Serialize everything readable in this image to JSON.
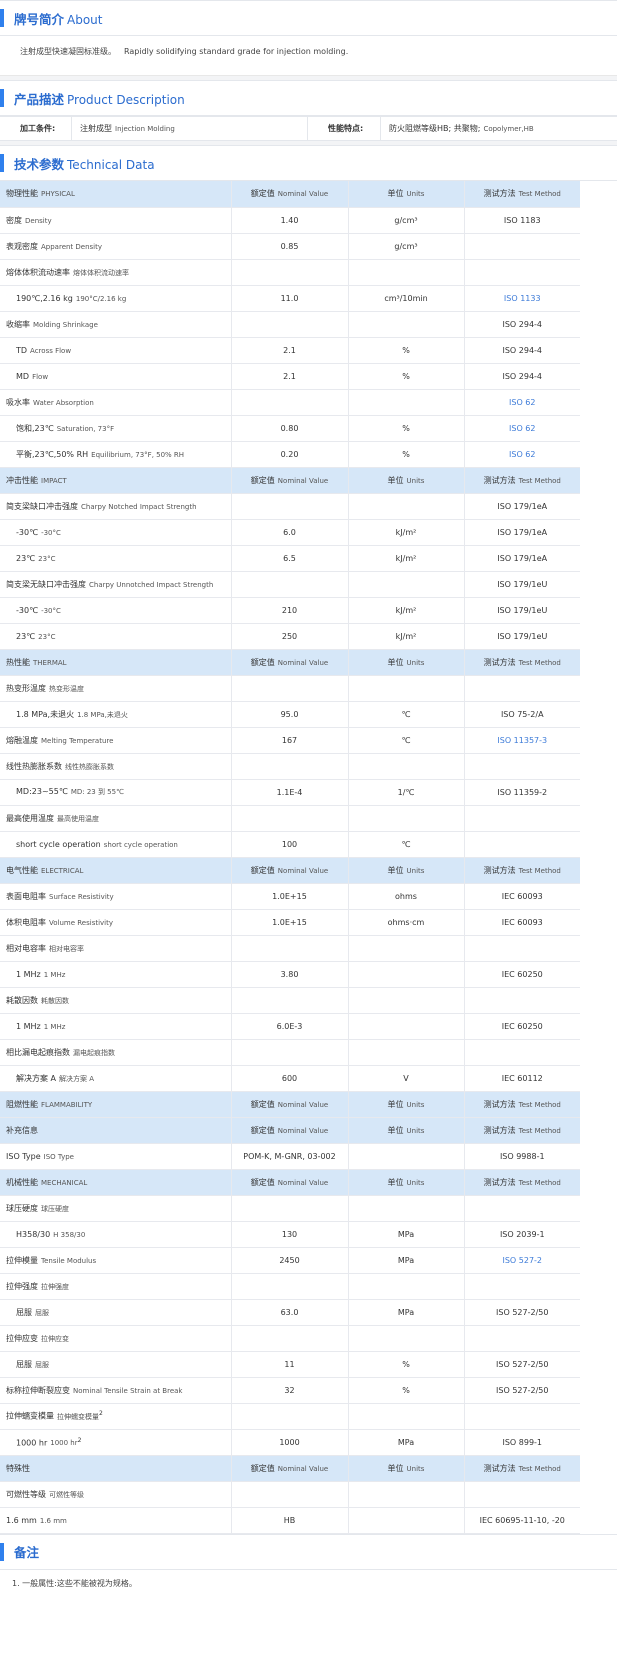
{
  "about": {
    "title_zh": "牌号简介",
    "title_en": "About",
    "text_zh": "注射成型快速凝固标准级。",
    "text_en": "Rapidly solidifying standard grade for injection molding."
  },
  "product_description": {
    "title_zh": "产品描述",
    "title_en": "Product Description",
    "processing_label": "加工条件:",
    "processing_value_zh": "注射成型",
    "processing_value_en": "Injection Molding",
    "features_label": "性能特点:",
    "features_value_zh": "防火阻燃等级HB; 共聚物;",
    "features_value_en": "Copolymer,HB"
  },
  "technical_data": {
    "title_zh": "技术参数",
    "title_en": "Technical Data",
    "rows": [
      {
        "type": "cat",
        "zh": "物理性能",
        "en": "PHYSICAL"
      },
      {
        "zh": "密度",
        "en": "Density",
        "value": "1.40",
        "unit": "g/cm³",
        "method": "ISO 1183"
      },
      {
        "zh": "表观密度",
        "en": "Apparent Density",
        "value": "0.85",
        "unit": "g/cm³",
        "method": ""
      },
      {
        "zh": "熔体体积流动速率",
        "en": "熔体体积流动速率",
        "value": "",
        "unit": "",
        "method": ""
      },
      {
        "sub": true,
        "zh": "190℃,2.16 kg",
        "en": "190°C/2.16 kg",
        "value": "11.0",
        "unit": "cm³/10min",
        "method": "ISO 1133",
        "link": true
      },
      {
        "zh": "收缩率",
        "en": "Molding Shrinkage",
        "value": "",
        "unit": "",
        "method": "ISO 294-4"
      },
      {
        "sub": true,
        "zh": "TD",
        "en": "Across Flow",
        "value": "2.1",
        "unit": "%",
        "method": "ISO 294-4"
      },
      {
        "sub": true,
        "zh": "MD",
        "en": "Flow",
        "value": "2.1",
        "unit": "%",
        "method": "ISO 294-4"
      },
      {
        "zh": "吸水率",
        "en": "Water Absorption",
        "value": "",
        "unit": "",
        "method": "ISO 62",
        "link": true
      },
      {
        "sub": true,
        "zh": "饱和,23℃",
        "en": "Saturation, 73°F",
        "value": "0.80",
        "unit": "%",
        "method": "ISO 62",
        "link": true
      },
      {
        "sub": true,
        "zh": "平衡,23℃,50% RH",
        "en": "Equilibrium, 73°F, 50% RH",
        "value": "0.20",
        "unit": "%",
        "method": "ISO 62",
        "link": true
      },
      {
        "type": "cat",
        "zh": "冲击性能",
        "en": "IMPACT"
      },
      {
        "zh": "简支梁缺口冲击强度",
        "en": "Charpy Notched Impact Strength",
        "value": "",
        "unit": "",
        "method": "ISO 179/1eA"
      },
      {
        "sub": true,
        "zh": "-30℃",
        "en": "-30°C",
        "value": "6.0",
        "unit": "kJ/m²",
        "method": "ISO 179/1eA"
      },
      {
        "sub": true,
        "zh": "23℃",
        "en": "23°C",
        "value": "6.5",
        "unit": "kJ/m²",
        "method": "ISO 179/1eA"
      },
      {
        "zh": "简支梁无缺口冲击强度",
        "en": "Charpy Unnotched Impact Strength",
        "value": "",
        "unit": "",
        "method": "ISO 179/1eU"
      },
      {
        "sub": true,
        "zh": "-30℃",
        "en": "-30°C",
        "value": "210",
        "unit": "kJ/m²",
        "method": "ISO 179/1eU"
      },
      {
        "sub": true,
        "zh": "23℃",
        "en": "23°C",
        "value": "250",
        "unit": "kJ/m²",
        "method": "ISO 179/1eU"
      },
      {
        "type": "cat",
        "zh": "热性能",
        "en": "THERMAL"
      },
      {
        "zh": "热变形温度",
        "en": "热变形温度",
        "value": "",
        "unit": "",
        "method": ""
      },
      {
        "sub": true,
        "zh": "1.8 MPa,未退火",
        "en": "1.8 MPa,未退火",
        "value": "95.0",
        "unit": "℃",
        "method": "ISO 75-2/A"
      },
      {
        "zh": "熔融温度",
        "en": "Melting Temperature",
        "value": "167",
        "unit": "℃",
        "method": "ISO 11357-3",
        "link": true
      },
      {
        "zh": "线性热膨胀系数",
        "en": "线性热膨胀系数",
        "value": "",
        "unit": "",
        "method": ""
      },
      {
        "sub": true,
        "zh": "MD:23~55℃",
        "en": "MD: 23 到 55℃",
        "value": "1.1E-4",
        "unit": "1/℃",
        "method": "ISO 11359-2"
      },
      {
        "zh": "最高使用温度",
        "en": "最高使用温度",
        "value": "",
        "unit": "",
        "method": ""
      },
      {
        "sub": true,
        "zh": "short cycle operation",
        "en": "short cycle operation",
        "value": "100",
        "unit": "℃",
        "method": ""
      },
      {
        "type": "cat",
        "zh": "电气性能",
        "en": "ELECTRICAL"
      },
      {
        "zh": "表面电阻率",
        "en": "Surface Resistivity",
        "value": "1.0E+15",
        "unit": "ohms",
        "method": "IEC 60093"
      },
      {
        "zh": "体积电阻率",
        "en": "Volume Resistivity",
        "value": "1.0E+15",
        "unit": "ohms·cm",
        "method": "IEC 60093"
      },
      {
        "zh": "相对电容率",
        "en": "相对电容率",
        "value": "",
        "unit": "",
        "method": ""
      },
      {
        "sub": true,
        "zh": "1 MHz",
        "en": "1 MHz",
        "value": "3.80",
        "unit": "",
        "method": "IEC 60250"
      },
      {
        "zh": "耗散因数",
        "en": "耗散因数",
        "value": "",
        "unit": "",
        "method": ""
      },
      {
        "sub": true,
        "zh": "1 MHz",
        "en": "1 MHz",
        "value": "6.0E-3",
        "unit": "",
        "method": "IEC 60250"
      },
      {
        "zh": "相比漏电起痕指数",
        "en": "漏电起痕指数",
        "value": "",
        "unit": "",
        "method": ""
      },
      {
        "sub": true,
        "zh": "解决方案 A",
        "en": "解决方案 A",
        "value": "600",
        "unit": "V",
        "method": "IEC 60112"
      },
      {
        "type": "cat",
        "zh": "阻燃性能",
        "en": "FLAMMABILITY"
      },
      {
        "type": "cat",
        "zh": "补充信息",
        "en": ""
      },
      {
        "zh": "ISO Type",
        "en": "ISO Type",
        "value": "POM-K, M-GNR, 03-002",
        "unit": "",
        "method": "ISO 9988-1"
      },
      {
        "type": "cat",
        "zh": "机械性能",
        "en": "MECHANICAL"
      },
      {
        "zh": "球压硬度",
        "en": "球压硬度",
        "value": "",
        "unit": "",
        "method": ""
      },
      {
        "sub": true,
        "zh": "H358/30",
        "en": "H 358/30",
        "value": "130",
        "unit": "MPa",
        "method": "ISO 2039-1"
      },
      {
        "zh": "拉伸模量",
        "en": "Tensile Modulus",
        "value": "2450",
        "unit": "MPa",
        "method": "ISO 527-2",
        "link": true
      },
      {
        "zh": "拉伸强度",
        "en": "拉伸强度",
        "value": "",
        "unit": "",
        "method": ""
      },
      {
        "sub": true,
        "zh": "屈服",
        "en": "屈服",
        "value": "63.0",
        "unit": "MPa",
        "method": "ISO 527-2/50"
      },
      {
        "zh": "拉伸应变",
        "en": "拉伸应变",
        "value": "",
        "unit": "",
        "method": ""
      },
      {
        "sub": true,
        "zh": "屈服",
        "en": "屈服",
        "value": "11",
        "unit": "%",
        "method": "ISO 527-2/50"
      },
      {
        "zh": "标称拉伸断裂应变",
        "en": "Nominal Tensile Strain at Break",
        "value": "32",
        "unit": "%",
        "method": "ISO 527-2/50"
      },
      {
        "zh": "拉伸蠕变模量",
        "en": "拉伸蠕变模量",
        "sup": "2",
        "value": "",
        "unit": "",
        "method": ""
      },
      {
        "sub": true,
        "zh": "1000 hr",
        "en": "1000 hr",
        "sup": "2",
        "value": "1000",
        "unit": "MPa",
        "method": "ISO 899-1"
      },
      {
        "type": "cat",
        "zh": "特殊性",
        "en": ""
      },
      {
        "zh": "可燃性等级",
        "en": "可燃性等级",
        "value": "",
        "unit": "",
        "method": ""
      },
      {
        "zh": "1.6 mm",
        "en": "1.6 mm",
        "value": "HB",
        "unit": "",
        "method": "IEC 60695-11-10, -20"
      }
    ],
    "headers": {
      "value_zh": "额定值",
      "value_en": "Nominal Value",
      "unit_zh": "单位",
      "unit_en": "Units",
      "method_zh": "测试方法",
      "method_en": "Test Method"
    }
  },
  "notes": {
    "title_zh": "备注",
    "text": "1. 一般属性:这些不能被视为规格。"
  }
}
